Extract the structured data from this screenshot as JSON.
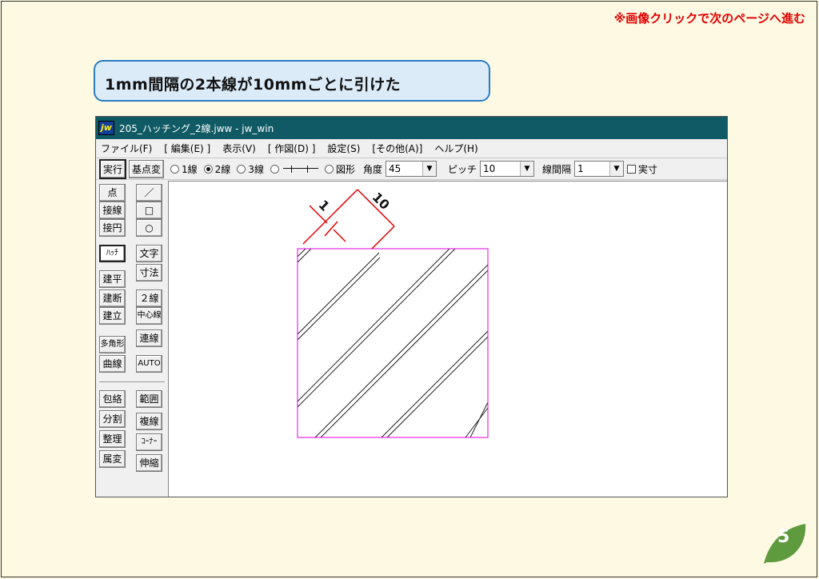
{
  "top_note": "※画像クリックで次のページへ進む",
  "caption": "1mm間隔の2本線が10mmごとに引けた",
  "window": {
    "app_icon": "jw",
    "title": "205_ハッチング_2線.jww - jw_win"
  },
  "menu": [
    "ファイル(F)",
    "[ 編集(E) ]",
    "表示(V)",
    "[ 作図(D) ]",
    "設定(S)",
    "[その他(A)]",
    "ヘルプ(H)"
  ],
  "toolbar": {
    "exec": "実行",
    "base_change": "基点変",
    "radio_1": "1線",
    "radio_2": "2線",
    "radio_3": "3線",
    "radio_shape": "図形",
    "angle_label": "角度",
    "angle_value": "45",
    "pitch_label": "ピッチ",
    "pitch_value": "10",
    "interval_label": "線間隔",
    "interval_value": "1",
    "actual_label": "実寸",
    "selected_radio": "2線"
  },
  "tools_left": [
    "点",
    "接線",
    "接円",
    "ﾊｯﾁ",
    "建平",
    "建断",
    "建立",
    "多角形",
    "曲線",
    "包絡",
    "分割",
    "整理",
    "属変"
  ],
  "tools_right": [
    "／",
    "□",
    "○",
    "文字",
    "寸法",
    "２線",
    "中心線",
    "連線",
    "AUTO",
    "範囲",
    "複線",
    "ｺｰﾅｰ",
    "伸縮"
  ],
  "selected_tool": "ﾊｯﾁ",
  "drawing": {
    "dim_small": "1",
    "dim_large": "10",
    "hatch_color": "#222222",
    "boundary_color": "#e000e0",
    "dim_color": "#e00000"
  },
  "page_number": "5",
  "colors": {
    "background": "#fdf9e3",
    "caption_bg": "#dcebf8",
    "caption_border": "#2a7dc4",
    "titlebar": "#0f5a64",
    "note": "#e00000",
    "leaf": "#5e9a3e"
  }
}
